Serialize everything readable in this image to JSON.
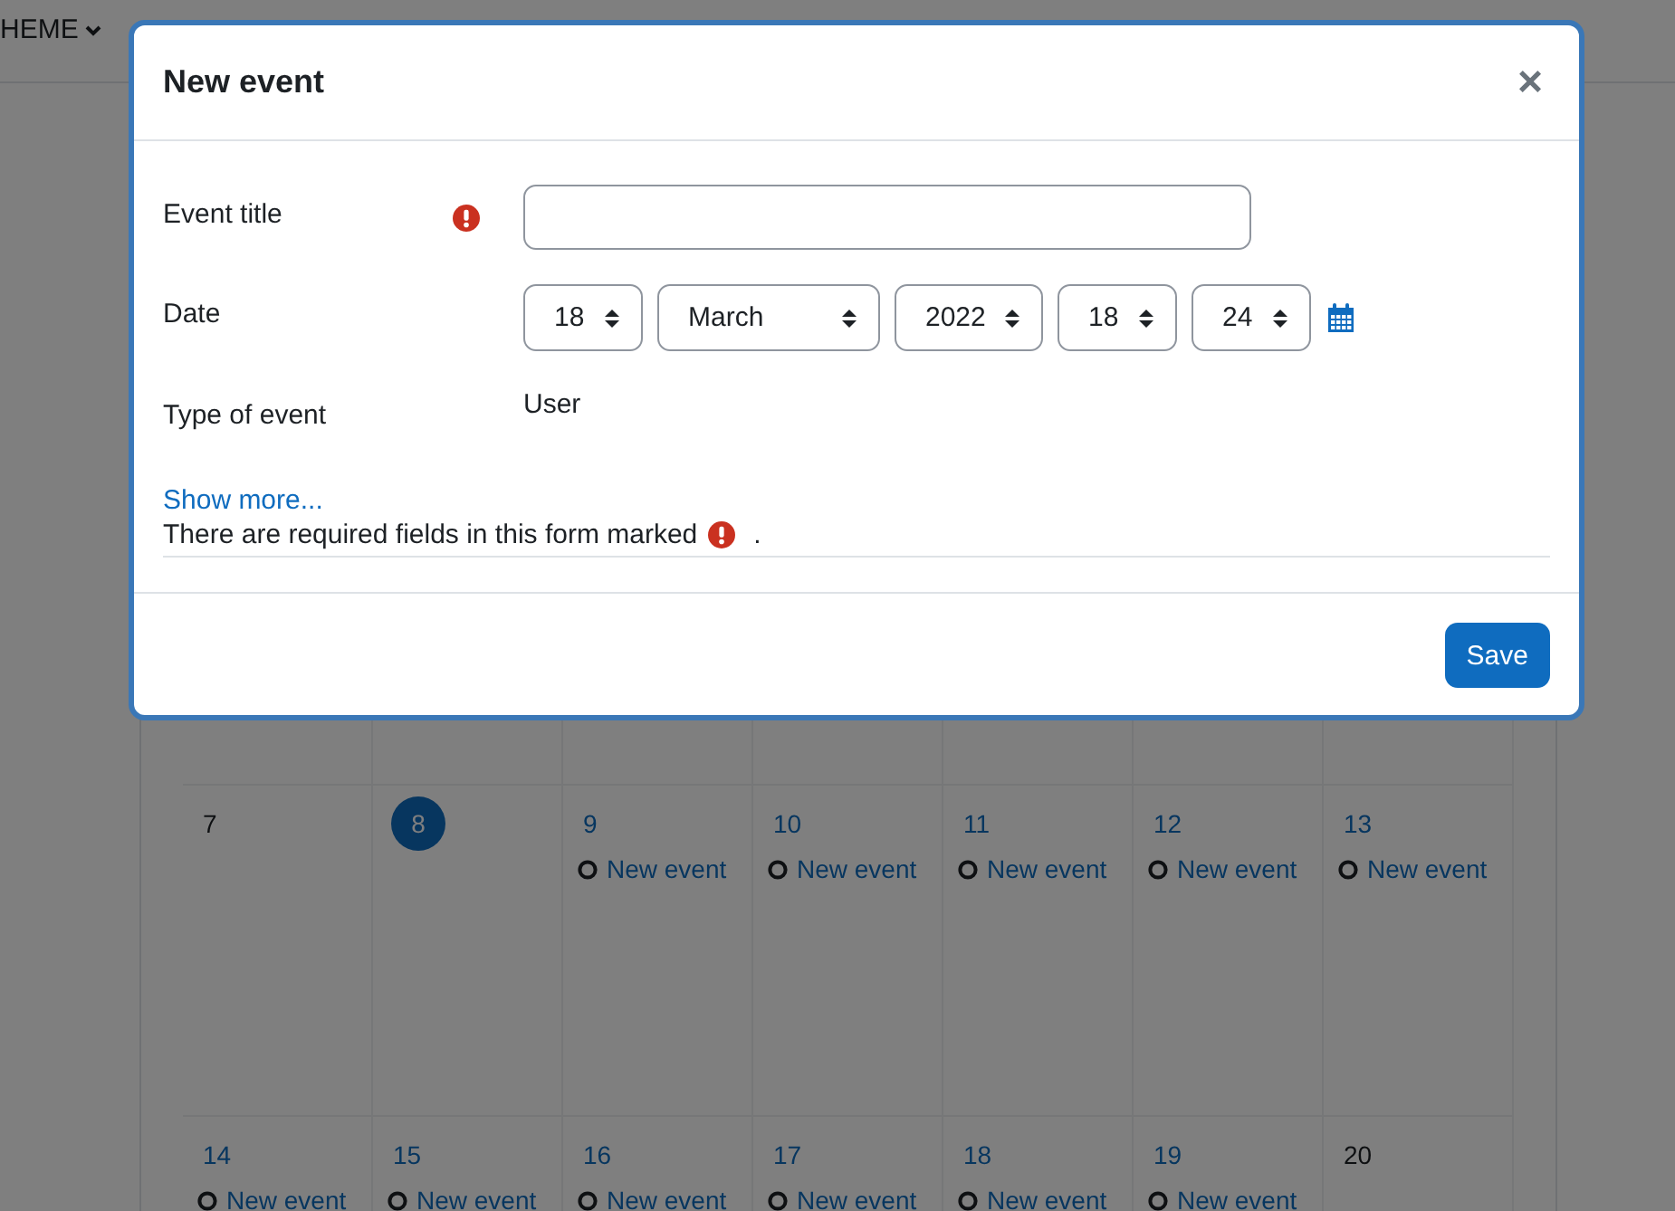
{
  "nav": {
    "menu_label": "HEME"
  },
  "calendar": {
    "weeks": [
      {
        "days": [
          {
            "number": "7",
            "today": false
          },
          {
            "number": "8",
            "today": true
          },
          {
            "number": "9",
            "today": false,
            "events": [
              "New event"
            ]
          },
          {
            "number": "10",
            "today": false,
            "events": [
              "New event"
            ]
          },
          {
            "number": "11",
            "today": false,
            "events": [
              "New event"
            ]
          },
          {
            "number": "12",
            "today": false,
            "events": [
              "New event"
            ]
          },
          {
            "number": "13",
            "today": false,
            "events": [
              "New event"
            ]
          }
        ]
      },
      {
        "days": [
          {
            "number": "14",
            "today": false,
            "events": [
              "New event"
            ]
          },
          {
            "number": "15",
            "today": false,
            "events": [
              "New event"
            ]
          },
          {
            "number": "16",
            "today": false,
            "events": [
              "New event"
            ]
          },
          {
            "number": "17",
            "today": false,
            "events": [
              "New event"
            ]
          },
          {
            "number": "18",
            "today": false,
            "events": [
              "New event"
            ]
          },
          {
            "number": "19",
            "today": false,
            "events": [
              "New event"
            ]
          },
          {
            "number": "20",
            "today": false
          }
        ]
      }
    ]
  },
  "modal": {
    "title": "New event",
    "close_label": "×",
    "fields": [
      {
        "kind": "text",
        "label": "Event title",
        "required": true
      },
      {
        "kind": "date",
        "label": "Date",
        "required": false,
        "selects": [
          "18",
          "March",
          "2022",
          "18",
          "24"
        ]
      },
      {
        "kind": "static",
        "label": "Type of event",
        "required": false,
        "value": "User"
      }
    ],
    "show_more": "Show more...",
    "required_note": "There are required fields in this form marked",
    "required_note_end": ".",
    "save_label": "Save"
  }
}
